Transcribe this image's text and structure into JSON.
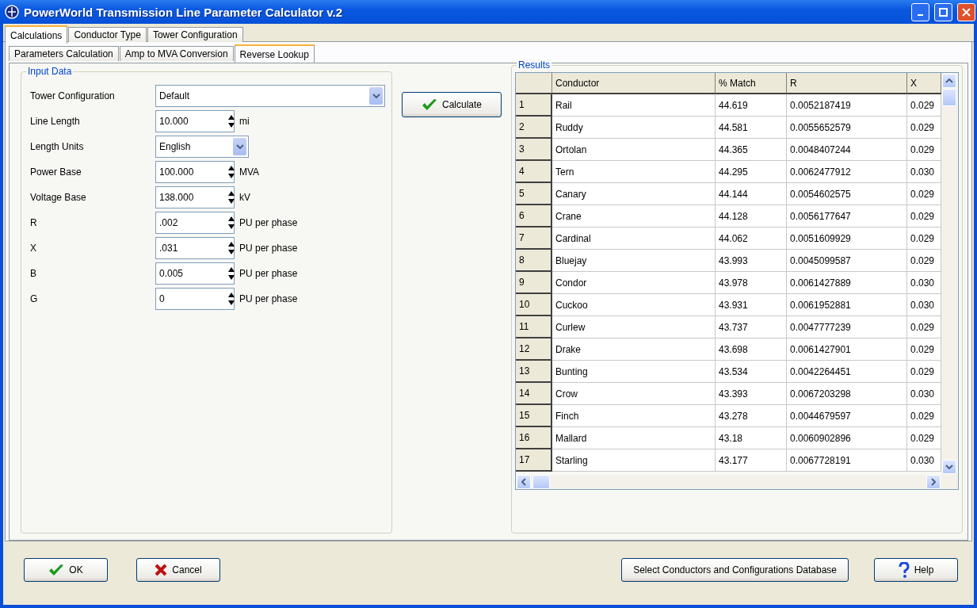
{
  "window": {
    "title": "PowerWorld Transmission Line Parameter Calculator v.2"
  },
  "tabs": [
    {
      "label": "Calculations",
      "selected": true
    },
    {
      "label": "Conductor Type",
      "selected": false
    },
    {
      "label": "Tower Configuration",
      "selected": false
    }
  ],
  "subtabs": [
    {
      "label": "Parameters Calculation",
      "selected": false
    },
    {
      "label": "Amp to MVA Conversion",
      "selected": false
    },
    {
      "label": "Reverse Lookup",
      "selected": true
    }
  ],
  "input_data": {
    "title": "Input Data",
    "fields": [
      {
        "kind": "dropdown",
        "label": "Tower Configuration",
        "value": "Default",
        "wide": true
      },
      {
        "kind": "spin",
        "label": "Line Length",
        "value": "10.000",
        "unit": "mi"
      },
      {
        "kind": "dropdown",
        "label": "Length Units",
        "value": "English"
      },
      {
        "kind": "spin",
        "label": "Power Base",
        "value": "100.000",
        "unit": "MVA"
      },
      {
        "kind": "spin",
        "label": "Voltage Base",
        "value": "138.000",
        "unit": "kV"
      },
      {
        "kind": "spin",
        "label": "R",
        "value": ".002",
        "unit": "PU per phase"
      },
      {
        "kind": "spin",
        "label": "X",
        "value": ".031",
        "unit": "PU per phase"
      },
      {
        "kind": "spin",
        "label": "B",
        "value": "0.005",
        "unit": "PU per phase"
      },
      {
        "kind": "spin",
        "label": "G",
        "value": "0",
        "unit": "PU per phase"
      }
    ]
  },
  "calculate_button": "Calculate",
  "results": {
    "title": "Results",
    "columns": [
      "",
      "Conductor",
      "% Match",
      "R",
      "X"
    ],
    "rows": [
      [
        "1",
        "Rail",
        "44.619",
        "0.0052187419",
        "0.029"
      ],
      [
        "2",
        "Ruddy",
        "44.581",
        "0.0055652579",
        "0.029"
      ],
      [
        "3",
        "Ortolan",
        "44.365",
        "0.0048407244",
        "0.029"
      ],
      [
        "4",
        "Tern",
        "44.295",
        "0.0062477912",
        "0.030"
      ],
      [
        "5",
        "Canary",
        "44.144",
        "0.0054602575",
        "0.029"
      ],
      [
        "6",
        "Crane",
        "44.128",
        "0.0056177647",
        "0.029"
      ],
      [
        "7",
        "Cardinal",
        "44.062",
        "0.0051609929",
        "0.029"
      ],
      [
        "8",
        "Bluejay",
        "43.993",
        "0.0045099587",
        "0.029"
      ],
      [
        "9",
        "Condor",
        "43.978",
        "0.0061427889",
        "0.030"
      ],
      [
        "10",
        "Cuckoo",
        "43.931",
        "0.0061952881",
        "0.030"
      ],
      [
        "11",
        "Curlew",
        "43.737",
        "0.0047777239",
        "0.029"
      ],
      [
        "12",
        "Drake",
        "43.698",
        "0.0061427901",
        "0.029"
      ],
      [
        "13",
        "Bunting",
        "43.534",
        "0.0042264451",
        "0.029"
      ],
      [
        "14",
        "Crow",
        "43.393",
        "0.0067203298",
        "0.030"
      ],
      [
        "15",
        "Finch",
        "43.278",
        "0.0044679597",
        "0.029"
      ],
      [
        "16",
        "Mallard",
        "43.18",
        "0.0060902896",
        "0.029"
      ],
      [
        "17",
        "Starling",
        "43.177",
        "0.0067728191",
        "0.030"
      ]
    ]
  },
  "footer": {
    "ok": "OK",
    "cancel": "Cancel",
    "database": "Select Conductors and Configurations Database",
    "help": "Help"
  }
}
